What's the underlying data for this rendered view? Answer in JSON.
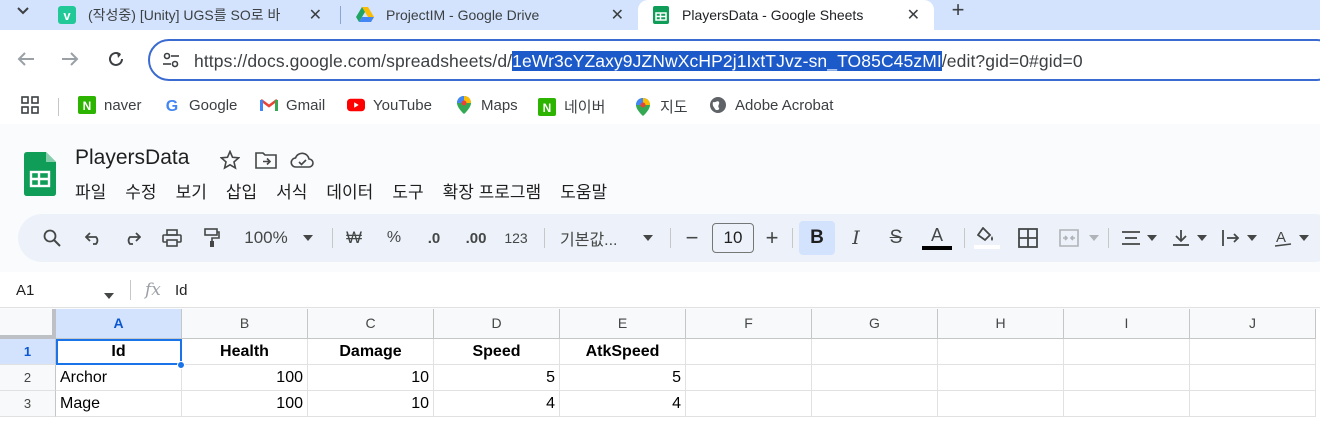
{
  "tabs": [
    {
      "title": "(작성중) [Unity] UGS를 SO로 바",
      "favicon": "velog-icon",
      "active": false
    },
    {
      "title": "ProjectIM - Google Drive",
      "favicon": "google-drive-icon",
      "active": false
    },
    {
      "title": "PlayersData - Google Sheets",
      "favicon": "google-sheets-icon",
      "active": true
    }
  ],
  "omnibox": {
    "url_prefix": "https://docs.google.com/spreadsheets/d/",
    "url_selected": "1eWr3cYZaxy9JZNwXcHP2j1IxtTJvz-sn_TO85C45zMI",
    "url_suffix": "/edit?gid=0#gid=0"
  },
  "bookmarks": [
    {
      "label": "naver",
      "icon": "naver-icon"
    },
    {
      "label": "Google",
      "icon": "google-icon"
    },
    {
      "label": "Gmail",
      "icon": "gmail-icon"
    },
    {
      "label": "YouTube",
      "icon": "youtube-icon"
    },
    {
      "label": "Maps",
      "icon": "maps-icon"
    },
    {
      "label": "네이버",
      "icon": "naver-icon"
    },
    {
      "label": "지도",
      "icon": "maps-icon"
    },
    {
      "label": "Adobe Acrobat",
      "icon": "globe-icon"
    }
  ],
  "document": {
    "title": "PlayersData",
    "menu": [
      "파일",
      "수정",
      "보기",
      "삽입",
      "서식",
      "데이터",
      "도구",
      "확장 프로그램",
      "도움말"
    ]
  },
  "toolbar": {
    "zoom": "100%",
    "currency": "₩",
    "percent": "%",
    "decrease_decimal": ".0",
    "increase_decimal": ".00",
    "number_format": "123",
    "font": "기본값...",
    "font_size": "10",
    "bold": "B",
    "italic": "I",
    "strikethrough": "S",
    "text_color": "A"
  },
  "formula_bar": {
    "name_box": "A1",
    "fx": "fx",
    "value": "Id"
  },
  "grid": {
    "columns": [
      "A",
      "B",
      "C",
      "D",
      "E",
      "F",
      "G",
      "H",
      "I",
      "J"
    ],
    "rows": [
      {
        "num": "1",
        "cells": [
          "Id",
          "Health",
          "Damage",
          "Speed",
          "AtkSpeed"
        ]
      },
      {
        "num": "2",
        "cells": [
          "Archor",
          "100",
          "10",
          "5",
          "5"
        ]
      },
      {
        "num": "3",
        "cells": [
          "Mage",
          "100",
          "10",
          "4",
          "4"
        ]
      }
    ],
    "selected_cell": "A1"
  },
  "colors": {
    "tabstrip": "#d3e3fd",
    "omnibox_border": "#3b6ad1",
    "selection": "#1d5ac9",
    "sheets_green": "#0f9d58",
    "active_cell": "#1a73e8"
  }
}
